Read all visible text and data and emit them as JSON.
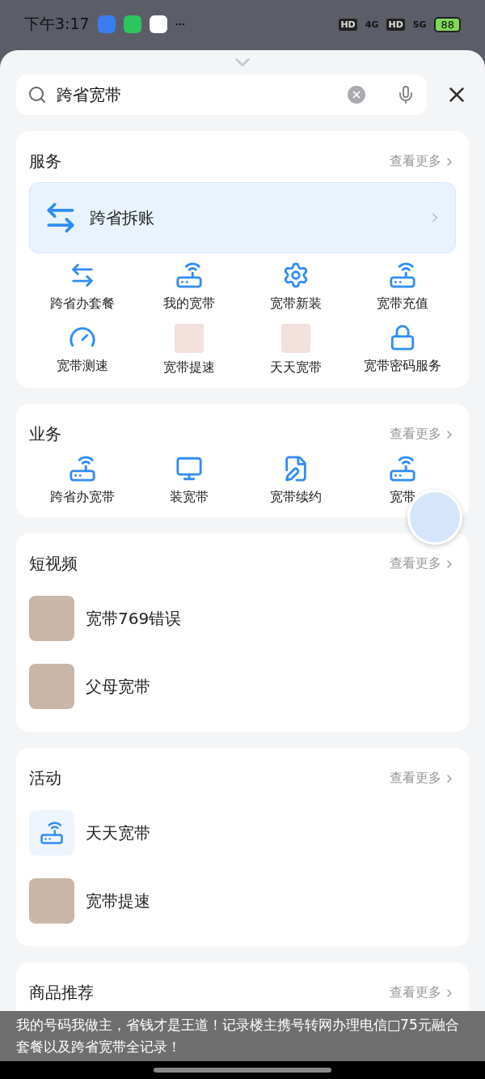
{
  "status_bar": {
    "time": "下午3:17",
    "hd_1": "HD",
    "network_1": "4G",
    "hd_2": "HD",
    "network_2": "5G",
    "battery": "88",
    "more": "···"
  },
  "search": {
    "value": "跨省宽带"
  },
  "sections": [
    {
      "kind": "grid",
      "title": "服务",
      "more": "查看更多",
      "banner": {
        "label": "跨省拆账"
      },
      "items": [
        {
          "label": "跨省办套餐",
          "kind": "icon"
        },
        {
          "label": "我的宽带",
          "kind": "icon"
        },
        {
          "label": "宽带新装",
          "kind": "icon"
        },
        {
          "label": "宽带充值",
          "kind": "icon"
        },
        {
          "label": "宽带测速",
          "kind": "icon"
        },
        {
          "label": "宽带提速",
          "kind": "image"
        },
        {
          "label": "天天宽带",
          "kind": "image"
        },
        {
          "label": "宽带密码服务",
          "kind": "icon"
        }
      ]
    },
    {
      "kind": "grid",
      "title": "业务",
      "more": "查看更多",
      "items": [
        {
          "label": "跨省办宽带",
          "kind": "icon"
        },
        {
          "label": "装宽带",
          "kind": "icon"
        },
        {
          "label": "宽带续约",
          "kind": "icon"
        },
        {
          "label": "宽带",
          "kind": "icon"
        }
      ]
    },
    {
      "kind": "list",
      "title": "短视频",
      "more": "查看更多",
      "items": [
        {
          "label": "宽带769错误",
          "kind": "image"
        },
        {
          "label": "父母宽带",
          "kind": "image"
        }
      ]
    },
    {
      "kind": "list",
      "title": "活动",
      "more": "查看更多",
      "items": [
        {
          "label": "天天宽带",
          "kind": "icon"
        },
        {
          "label": "宽带提速",
          "kind": "image"
        }
      ]
    },
    {
      "kind": "list",
      "title": "商品推荐",
      "more": "查看更多"
    }
  ],
  "caption": "我的号码我做主，省钱才是王道！记录楼主携号转网办理电信□75元融合套餐以及跨省宽带全记录！"
}
